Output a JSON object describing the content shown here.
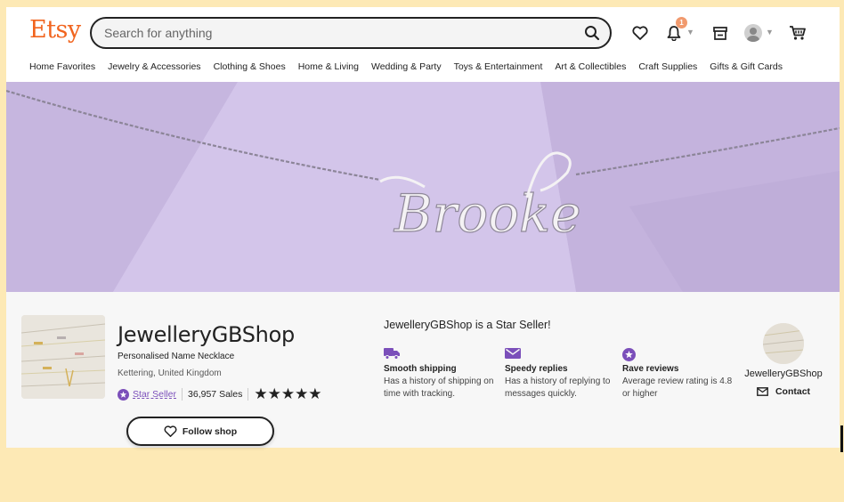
{
  "header": {
    "logo": "Etsy",
    "search_placeholder": "Search for anything",
    "notification_count": "1",
    "icons": [
      "heart-icon",
      "bell-icon",
      "shop-icon",
      "avatar",
      "cart-icon"
    ]
  },
  "nav": {
    "items": [
      "Home Favorites",
      "Jewelry & Accessories",
      "Clothing & Shoes",
      "Home & Living",
      "Wedding & Party",
      "Toys & Entertainment",
      "Art & Collectibles",
      "Craft Supplies",
      "Gifts & Gift Cards"
    ]
  },
  "banner": {
    "necklace_text": "Brooke"
  },
  "shop": {
    "name": "JewelleryGBShop",
    "tagline": "Personalised Name Necklace",
    "location": "Kettering, United Kingdom",
    "star_seller_label": "Star Seller",
    "sales": "36,957 Sales",
    "rating_stars": 5,
    "stars": "★★★★★",
    "follow_label": "Follow shop"
  },
  "star_seller": {
    "title": "JewelleryGBShop is a Star Seller!",
    "features": [
      {
        "title": "Smooth shipping",
        "desc": "Has a history of shipping on time with tracking.",
        "icon": "truck-icon"
      },
      {
        "title": "Speedy replies",
        "desc": "Has a history of replying to messages quickly.",
        "icon": "envelope-icon"
      },
      {
        "title": "Rave reviews",
        "desc": "Average review rating is 4.8 or higher",
        "icon": "star-badge-icon"
      }
    ]
  },
  "owner": {
    "name": "JewelleryGBShop",
    "contact_label": "Contact"
  },
  "colors": {
    "brand": "#f1641e",
    "star_seller_purple": "#7b4fba",
    "banner": "#cfc0e6",
    "page_bg": "#fde9b5"
  }
}
